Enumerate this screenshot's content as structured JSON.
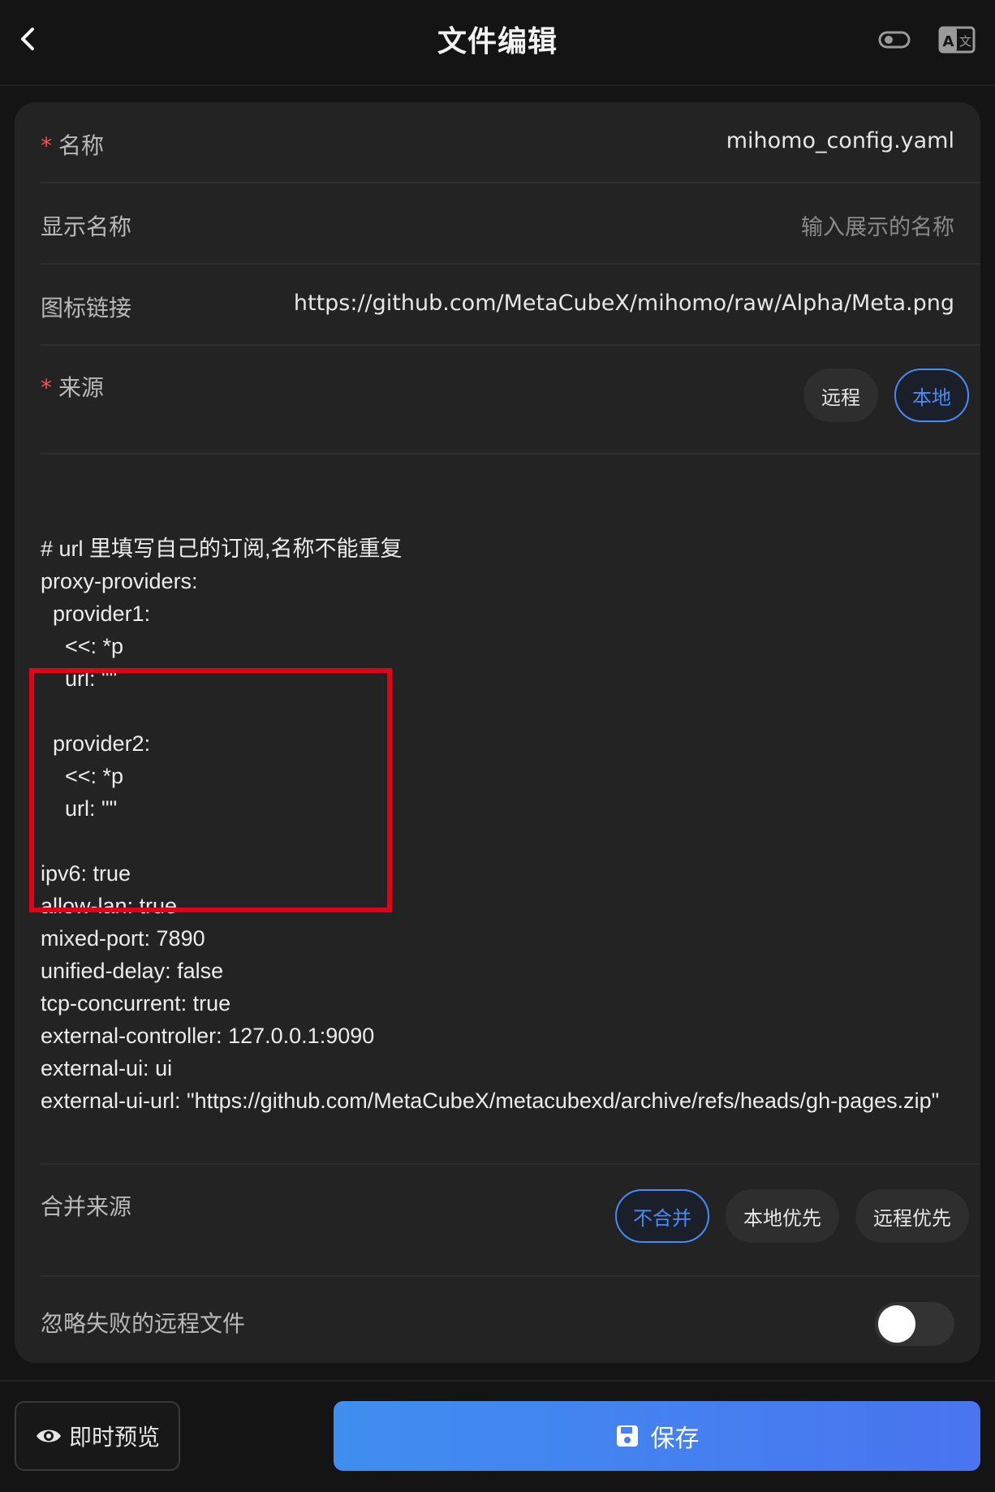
{
  "header": {
    "title": "文件编辑",
    "back_icon": "chevron-left-icon",
    "right_icons": [
      "toggle-icon",
      "translate-icon"
    ]
  },
  "form": {
    "name": {
      "required": "*",
      "label": "名称",
      "value": "mihomo_config.yaml"
    },
    "display_name": {
      "label": "显示名称",
      "placeholder": "输入展示的名称"
    },
    "icon_url": {
      "label": "图标链接",
      "value": "https://github.com/MetaCubeX/mihomo/raw/Alpha/Meta.png"
    },
    "source": {
      "required": "*",
      "label": "来源",
      "options": [
        "远程",
        "本地"
      ],
      "selected": "本地"
    },
    "code_lines": [
      "# url 里填写自己的订阅,名称不能重复",
      "proxy-providers:",
      "  provider1:",
      "    <<: *p",
      "    url: \"\"",
      "",
      "  provider2:",
      "    <<: *p",
      "    url: \"\"",
      "",
      "ipv6: true",
      "allow-lan: true",
      "mixed-port: 7890",
      "unified-delay: false",
      "tcp-concurrent: true",
      "external-controller: 127.0.0.1:9090",
      "external-ui: ui",
      "external-ui-url: \"https://github.com/MetaCubeX/metacubexd/archive/refs/heads/gh-pages.zip\""
    ],
    "merge_source": {
      "label": "合并来源",
      "options": [
        "不合并",
        "本地优先",
        "远程优先"
      ],
      "selected": "不合并"
    },
    "ignore_failed": {
      "label": "忽略失败的远程文件",
      "enabled": false
    }
  },
  "footer": {
    "preview_label": "即时预览",
    "preview_icon": "eye-icon",
    "save_label": "保存",
    "save_icon": "save-icon"
  },
  "colors": {
    "background": "#141414",
    "card": "#232323",
    "accent": "#4a8af4",
    "required": "#ff4d4f",
    "highlight_box": "#e3001b"
  }
}
